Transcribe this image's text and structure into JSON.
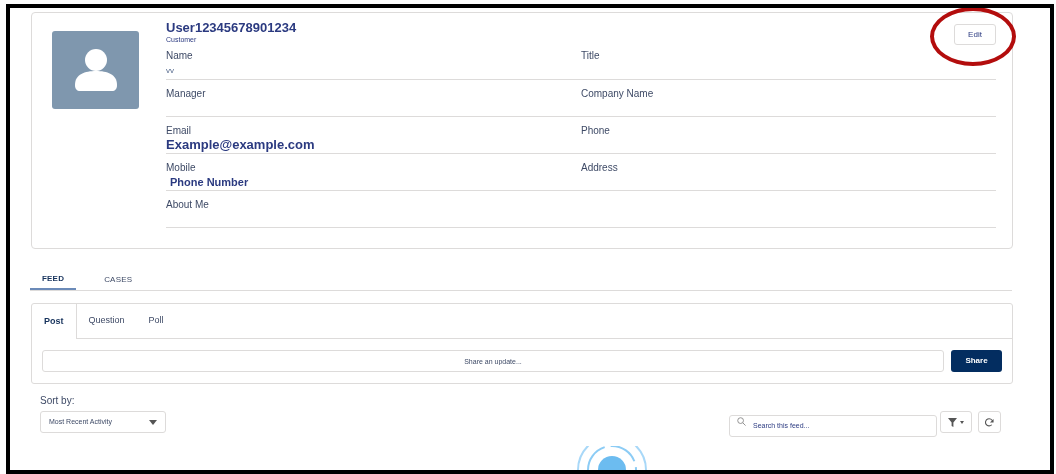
{
  "profile": {
    "name": "User12345678901234",
    "role": "Customer",
    "edit_button": "Edit",
    "rows": [
      {
        "left": {
          "label": "Name",
          "value": "vv",
          "kind": "small"
        },
        "right": {
          "label": "Title"
        }
      },
      {
        "left": {
          "label": "Manager"
        },
        "right": {
          "label": "Company Name"
        }
      },
      {
        "left": {
          "label": "Email",
          "value": "Example@example.com",
          "kind": "large"
        },
        "right": {
          "label": "Phone"
        }
      },
      {
        "left": {
          "label": "Mobile",
          "value": "Phone Number",
          "kind": "medium"
        },
        "right": {
          "label": "Address"
        }
      },
      {
        "left": {
          "label": "About Me"
        }
      }
    ]
  },
  "tabs": [
    {
      "label": "FEED",
      "selected": true
    },
    {
      "label": "CASES",
      "selected": false
    }
  ],
  "publisher": {
    "tabs": [
      {
        "label": "Post",
        "selected": true
      },
      {
        "label": "Question",
        "selected": false
      },
      {
        "label": "Poll",
        "selected": false
      }
    ],
    "input": {
      "placeholder": "Share an update..."
    },
    "share_button": "Share"
  },
  "sort": {
    "label": "Sort by:",
    "value": "Most Recent Activity"
  },
  "search": {
    "placeholder": "Search this feed..."
  }
}
